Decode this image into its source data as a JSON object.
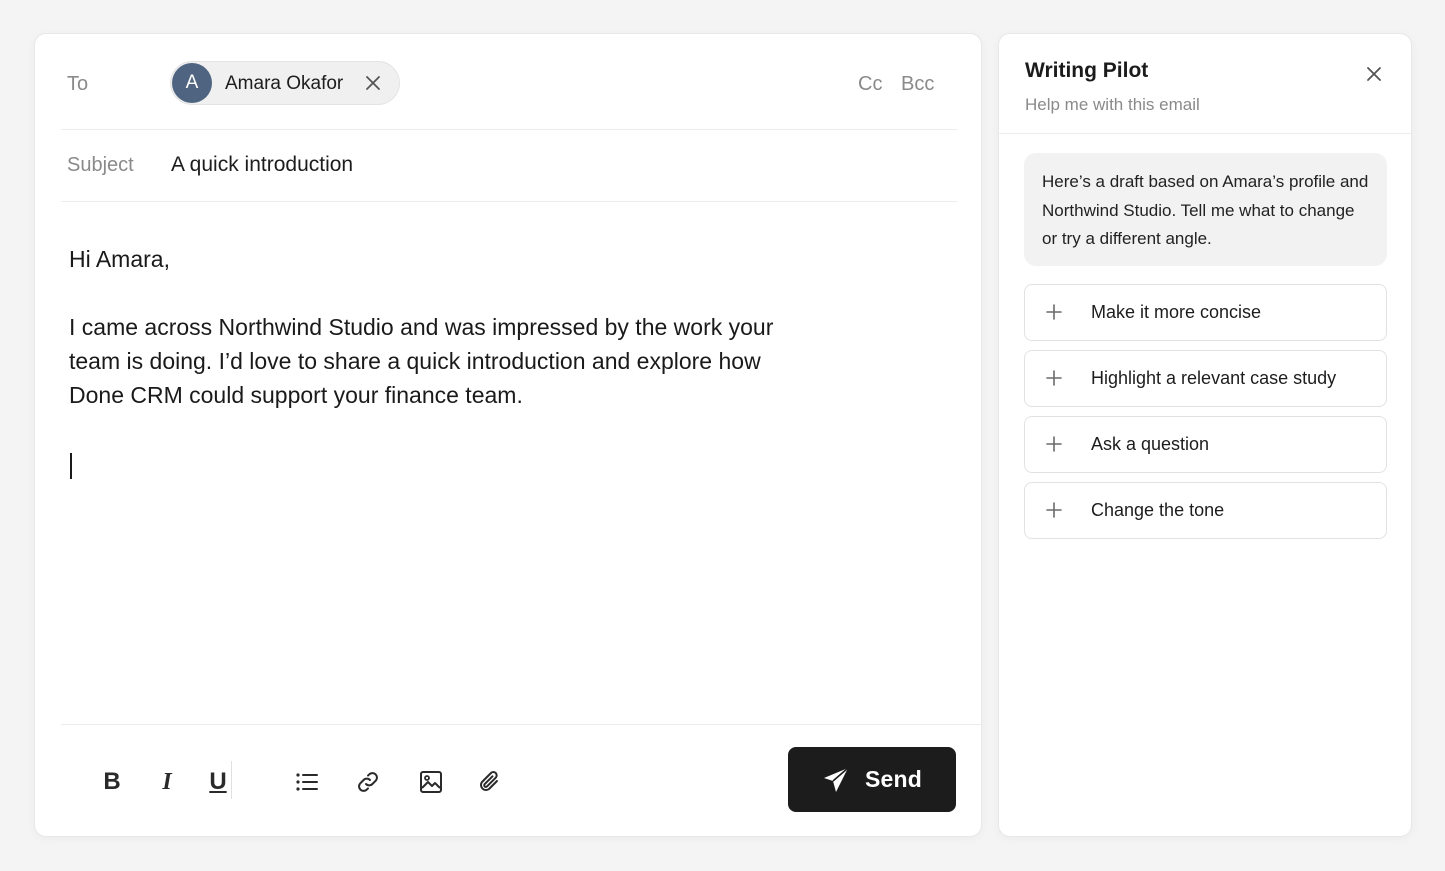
{
  "composer": {
    "to_label": "To",
    "recipient": {
      "initial": "A",
      "name": "Amara Okafor"
    },
    "cc_label": "Cc",
    "bcc_label": "Bcc",
    "subject_label": "Subject",
    "subject_value": "A quick introduction",
    "body": {
      "greeting": "Hi Amara,",
      "paragraph_lines": [
        "I came across Northwind Studio and was impressed by the work your",
        "team is doing. I’d love to share a quick introduction and explore how",
        "Done CRM could support your finance team."
      ]
    },
    "toolbar": {
      "bold": "B",
      "italic": "I",
      "underline": "U",
      "send_label": "Send"
    }
  },
  "pilot": {
    "title": "Writing Pilot",
    "subtitle": "Help me with this email",
    "message": "Here’s a draft based on Amara’s profile and Northwind Studio. Tell me what to change or try a different angle.",
    "suggestions": [
      {
        "label": "Make it more concise"
      },
      {
        "label": "Highlight a relevant case study"
      },
      {
        "label": "Ask a question"
      },
      {
        "label": "Change the tone"
      }
    ]
  },
  "icons": {
    "remove": "close-icon",
    "close": "close-icon",
    "list": "bulleted-list-icon",
    "link": "link-icon",
    "image": "image-icon",
    "attach": "paperclip-icon",
    "send": "paper-plane-icon",
    "suggestion": "plus-icon"
  },
  "colors": {
    "avatar": "#4e6480",
    "send_button": "#1c1c1c",
    "muted_text": "#8a8a8a"
  }
}
